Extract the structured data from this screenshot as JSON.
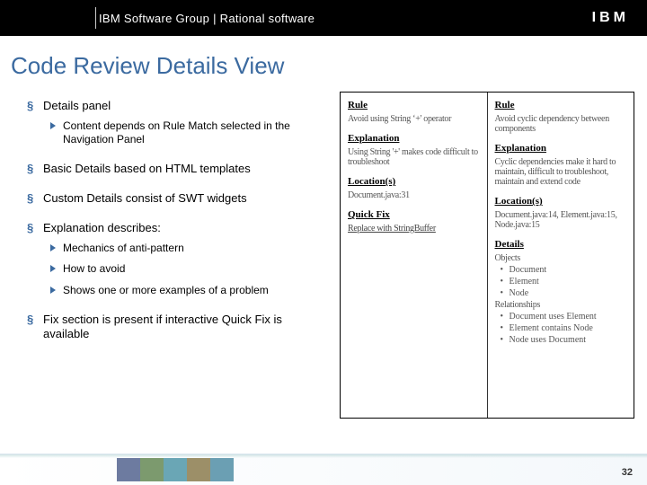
{
  "header": {
    "title": "IBM Software Group | Rational software",
    "logo": "IBM"
  },
  "page_title": "Code Review Details View",
  "bullets": [
    {
      "text": "Details panel",
      "children": [
        "Content depends on Rule Match selected in the Navigation Panel"
      ]
    },
    {
      "text": "Basic Details based on HTML templates"
    },
    {
      "text": "Custom Details consist of SWT widgets"
    },
    {
      "text": "Explanation describes:",
      "children": [
        "Mechanics of anti-pattern",
        "How to avoid",
        "Shows one or more examples of a problem"
      ]
    },
    {
      "text": "Fix section is present if interactive Quick Fix is available"
    }
  ],
  "left_panel": {
    "s1": "Rule",
    "t1": "Avoid using String ‘+' operator",
    "s2": "Explanation",
    "t2": "Using String '+' makes code difficult to troubleshoot",
    "s3": "Location(s)",
    "t3": "Document.java:31",
    "s4": "Quick Fix",
    "t4": "Replace with StringBuffer"
  },
  "right_panel": {
    "s1": "Rule",
    "t1": "Avoid cyclic dependency between components",
    "s2": "Explanation",
    "t2": "Cyclic dependencies make it hard to maintain, difficult to troubleshoot, maintain and extend code",
    "s3": "Location(s)",
    "t3": "Document.java:14, Element.java:15, Node.java:15",
    "s4": "Details",
    "objects_h": "Objects",
    "object_items": [
      "Document",
      "Element",
      "Node"
    ],
    "rel_h": "Relationships",
    "rel_items": [
      "Document uses Element",
      "Element contains Node",
      "Node uses Document"
    ]
  },
  "slide_number": "32"
}
